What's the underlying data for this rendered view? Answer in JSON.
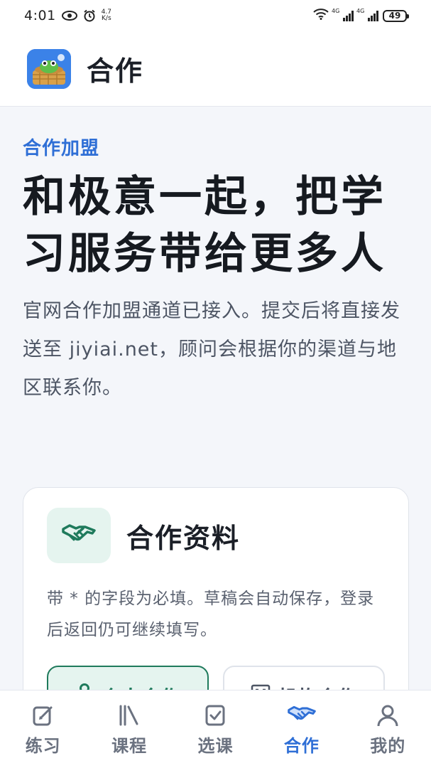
{
  "status_bar": {
    "time": "4:01",
    "net_speed_value": "4.7",
    "net_speed_unit": "K/s",
    "sig1_label": "4G",
    "sig2_label": "4G",
    "battery": "49"
  },
  "app_bar": {
    "title": "合作"
  },
  "hero": {
    "eyebrow": "合作加盟",
    "headline": "和极意一起，把学习服务带给更多人",
    "description": "官网合作加盟通道已接入。提交后将直接发送至 jiyiai.net，顾问会根据你的渠道与地区联系你。"
  },
  "card": {
    "title": "合作资料",
    "note": "带 * 的字段为必填。草稿会自动保存，登录后返回仍可继续填写。",
    "options": [
      {
        "label": "个人合作",
        "selected": true
      },
      {
        "label": "机构合作",
        "selected": false
      }
    ]
  },
  "tabs": [
    {
      "label": "练习",
      "icon": "edit-icon",
      "active": false
    },
    {
      "label": "课程",
      "icon": "books-icon",
      "active": false
    },
    {
      "label": "选课",
      "icon": "check-square-icon",
      "active": false
    },
    {
      "label": "合作",
      "icon": "handshake-icon",
      "active": true
    },
    {
      "label": "我的",
      "icon": "user-icon",
      "active": false
    }
  ],
  "colors": {
    "accent": "#2f6fd6",
    "green": "#1f7a5c",
    "green_bg": "#e5f4ef"
  }
}
